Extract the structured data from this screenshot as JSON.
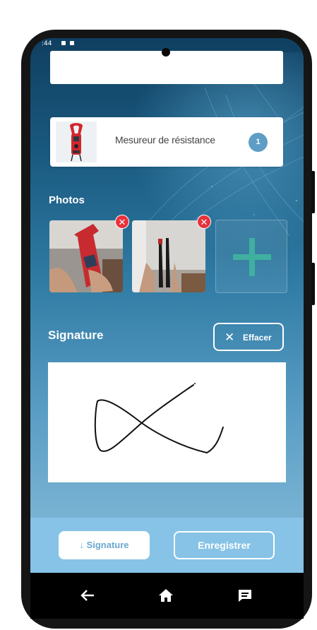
{
  "status_bar": {
    "time": ":44"
  },
  "product": {
    "name": "Mesureur de résistance",
    "quantity": "1"
  },
  "photos": {
    "title": "Photos",
    "items": [
      {
        "name": "photo-1",
        "delete_icon": "close-icon"
      },
      {
        "name": "photo-2",
        "delete_icon": "close-icon"
      }
    ],
    "add_icon": "plus-icon"
  },
  "signature": {
    "title": "Signature",
    "clear_label": "Effacer"
  },
  "actions": {
    "signature_label": "↓ Signature",
    "save_label": "Enregistrer"
  },
  "nav": {
    "back_icon": "back-arrow-icon",
    "home_icon": "home-icon",
    "recents_icon": "chat-icon"
  },
  "colors": {
    "accent": "#5e9dc6",
    "delete": "#e8323c",
    "add": "#3fb0a0",
    "bottom_bar": "#86c3e6"
  }
}
